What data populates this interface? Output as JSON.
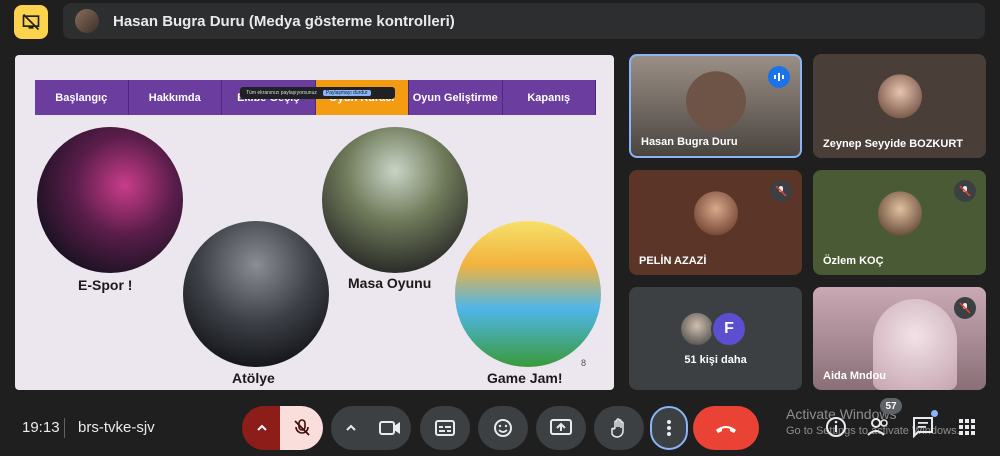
{
  "presenter": {
    "label": "Hasan Bugra Duru (Medya gösterme kontrolleri)"
  },
  "slide": {
    "nav": [
      "Başlangıç",
      "Hakkımda",
      "Ekibe Geçiş",
      "Oyun Kuracı",
      "Oyun Geliştirme",
      "Kapanış"
    ],
    "share_popup": {
      "text": "Tüm ekranınızı paylaşıyorsunuz",
      "button": "Paylaşmayı durdur"
    },
    "captions": {
      "espor": "E-Spor !",
      "atolye": "Atölye",
      "masa": "Masa Oyunu",
      "gamejam": "Game Jam!"
    },
    "page_number": "8"
  },
  "participants": [
    {
      "name": "Hasan Bugra Duru"
    },
    {
      "name": "Zeynep Seyyide BOZKURT"
    },
    {
      "name": "PELİN AZAZİ"
    },
    {
      "name": "Özlem KOÇ"
    },
    {
      "name": "51 kişi daha",
      "initial": "F"
    },
    {
      "name": "Aida Mndou"
    }
  ],
  "bottom_bar": {
    "time": "19:13",
    "meeting_code": "brs-tvke-sjv",
    "people_count": "57",
    "watermark_title": "Activate Windows",
    "watermark_sub": "Go to Settings to activate Windows."
  },
  "colors": {
    "accent_yellow": "#fcd34d",
    "end_call": "#ea4335",
    "mic_off_red": "#f9dedc",
    "nav_purple": "#6a3d9e",
    "nav_active": "#f39c12"
  }
}
